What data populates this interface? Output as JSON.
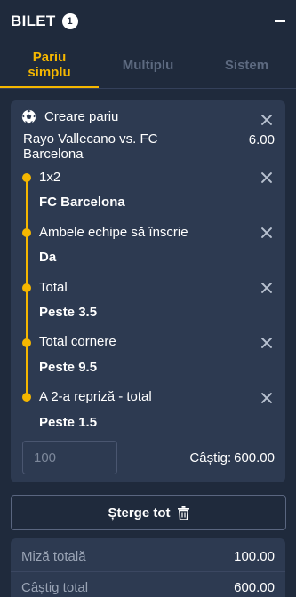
{
  "header": {
    "title": "BILET",
    "count": "1"
  },
  "tabs": [
    {
      "label": "Pariu simplu",
      "active": true
    },
    {
      "label": "Multiplu",
      "active": false
    },
    {
      "label": "Sistem",
      "active": false
    }
  ],
  "bet": {
    "title": "Creare pariu",
    "match": "Rayo Vallecano vs. FC Barcelona",
    "odds": "6.00",
    "selections": [
      {
        "market": "1x2",
        "pick": "FC Barcelona"
      },
      {
        "market": "Ambele echipe să înscrie",
        "pick": "Da"
      },
      {
        "market": "Total",
        "pick": "Peste 3.5"
      },
      {
        "market": "Total cornere",
        "pick": "Peste 9.5"
      },
      {
        "market": "A 2-a repriză - total",
        "pick": "Peste 1.5"
      }
    ],
    "stake_placeholder": "100",
    "win_label": "Câștig:",
    "win_value": "600.00"
  },
  "clear_all_label": "Șterge tot",
  "summary": {
    "total_stake_label": "Miză totală",
    "total_stake_value": "100.00",
    "total_win_label": "Câștig total",
    "total_win_value": "600.00"
  },
  "colors": {
    "accent": "#f5b700",
    "background": "#1f2a3c",
    "card": "#2d3a51"
  }
}
